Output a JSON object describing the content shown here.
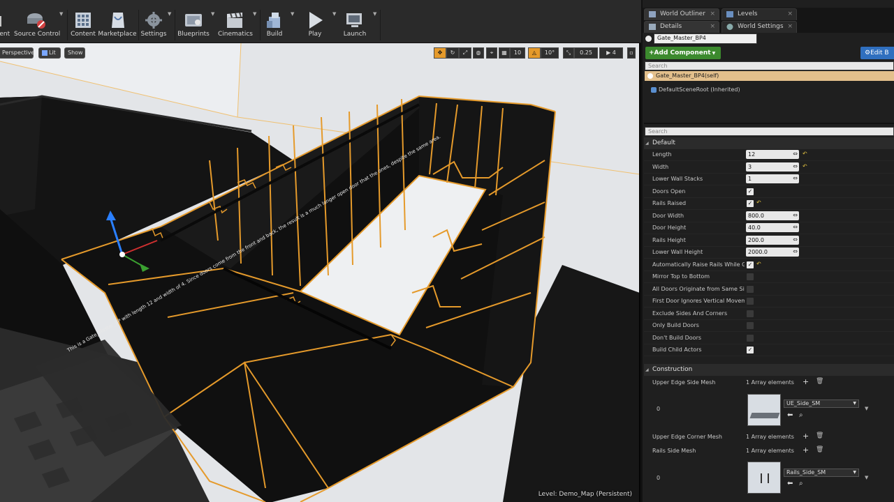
{
  "toolbar": {
    "items": [
      {
        "label": "rent",
        "icon": "folder-icon"
      },
      {
        "label": "Source Control",
        "icon": "source-control-icon"
      },
      {
        "label": "Content",
        "icon": "content-browser-icon"
      },
      {
        "label": "Marketplace",
        "icon": "marketplace-icon"
      },
      {
        "label": "Settings",
        "icon": "settings-gear-icon"
      },
      {
        "label": "Blueprints",
        "icon": "blueprints-icon"
      },
      {
        "label": "Cinematics",
        "icon": "cinematics-icon"
      },
      {
        "label": "Build",
        "icon": "build-icon"
      },
      {
        "label": "Play",
        "icon": "play-icon"
      },
      {
        "label": "Launch",
        "icon": "launch-icon"
      }
    ]
  },
  "viewport": {
    "perspective": "Perspective",
    "lit": "Lit",
    "show": "Show",
    "grid_snap": "10",
    "rotation_snap": "10°",
    "scale_snap": "0.25",
    "camera_speed": "4",
    "level_prefix": "Level:",
    "level_name": "Demo_Map (Persistent)",
    "note_text": "This is a Gate_Master_BP with length 12 and width of 4. Since doors come from the front and back, the result is a much longer open door that the ones, despite the same area.",
    "accent_color": "#e59a2b"
  },
  "panel": {
    "tabs_top": [
      {
        "label": "World Outliner",
        "icon": "world-outliner-icon"
      },
      {
        "label": "Levels",
        "icon": "levels-icon"
      }
    ],
    "tabs_second": [
      {
        "label": "Details",
        "icon": "details-icon"
      },
      {
        "label": "World Settings",
        "icon": "world-settings-icon"
      }
    ],
    "actor_name": "Gate_Master_BP4",
    "add_component": "+Add Component",
    "edit_blueprint": "Edit B",
    "search_placeholder": "Search",
    "components": [
      {
        "label": "Gate_Master_BP4(self)"
      },
      {
        "label": "DefaultSceneRoot (Inherited)"
      }
    ],
    "details_search_placeholder": "Search",
    "default_section": "Default",
    "properties": [
      {
        "label": "Length",
        "type": "num",
        "value": "12",
        "reset": true
      },
      {
        "label": "Width",
        "type": "num",
        "value": "3",
        "reset": true
      },
      {
        "label": "Lower Wall Stacks",
        "type": "num",
        "value": "1",
        "reset": false
      },
      {
        "label": "Doors Open",
        "type": "check",
        "value": "✓",
        "reset": false
      },
      {
        "label": "Rails Raised",
        "type": "check",
        "value": "✓",
        "reset": true
      },
      {
        "label": "Door Width",
        "type": "num",
        "value": "800.0",
        "reset": false
      },
      {
        "label": "Door Height",
        "type": "num",
        "value": "40.0",
        "reset": false
      },
      {
        "label": "Rails Height",
        "type": "num",
        "value": "200.0",
        "reset": false
      },
      {
        "label": "Lower Wall Height",
        "type": "num",
        "value": "2000.0",
        "reset": false
      },
      {
        "label": "Automatically Raise Rails While Gat",
        "type": "check",
        "value": "✓",
        "reset": true
      },
      {
        "label": "Mirror Top to Bottom",
        "type": "check",
        "value": "",
        "reset": false
      },
      {
        "label": "All Doors Originate from Same Side",
        "type": "check",
        "value": "",
        "reset": false
      },
      {
        "label": "First Door Ignores Vertical Moveme",
        "type": "check",
        "value": "",
        "reset": false
      },
      {
        "label": "Exclude Sides And Corners",
        "type": "check",
        "value": "",
        "reset": false
      },
      {
        "label": "Only Build Doors",
        "type": "check",
        "value": "",
        "reset": false
      },
      {
        "label": "Don't Build Doors",
        "type": "check",
        "value": "",
        "reset": false
      },
      {
        "label": "Build Child Actors",
        "type": "check",
        "value": "✓",
        "reset": false
      }
    ],
    "construction_section": "Construction",
    "arrays": [
      {
        "label": "Upper Edge Side Mesh",
        "count": "1 Array elements",
        "index": "0",
        "mesh": "UE_Side_SM"
      },
      {
        "label": "Upper Edge Corner Mesh",
        "count": "1 Array elements"
      },
      {
        "label": "Rails Side Mesh",
        "count": "1 Array elements",
        "index": "0",
        "mesh": "Rails_Side_SM"
      }
    ]
  }
}
